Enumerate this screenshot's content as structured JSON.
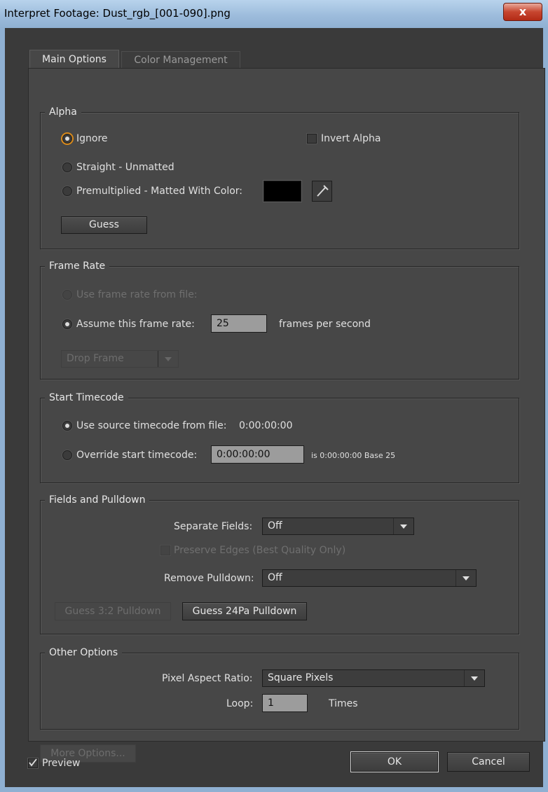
{
  "window": {
    "title": "Interpret Footage: Dust_rgb_[001-090].png",
    "close_glyph": "x"
  },
  "tabs": [
    {
      "label": "Main Options"
    },
    {
      "label": "Color Management"
    }
  ],
  "alpha": {
    "title": "Alpha",
    "ignore_label": "Ignore",
    "invert_label": "Invert Alpha",
    "straight_label": "Straight - Unmatted",
    "premult_label": "Premultiplied - Matted With Color:",
    "matte_color": "#000000",
    "guess_label": "Guess"
  },
  "frame_rate": {
    "title": "Frame Rate",
    "use_file_label": "Use frame rate from file:",
    "assume_label": "Assume this frame rate:",
    "fps_value": "25",
    "fps_suffix": "frames per second",
    "drop_frame": "Drop Frame"
  },
  "start_timecode": {
    "title": "Start Timecode",
    "source_label": "Use source timecode from file:",
    "source_value": "0:00:00:00",
    "override_label": "Override start timecode:",
    "override_value": "0:00:00:00",
    "info": "is 0:00:00:00  Base 25"
  },
  "fields": {
    "title": "Fields and Pulldown",
    "separate_label": "Separate Fields:",
    "separate_value": "Off",
    "preserve_label": "Preserve Edges (Best Quality Only)",
    "remove_label": "Remove Pulldown:",
    "remove_value": "Off",
    "guess32_label": "Guess 3:2 Pulldown",
    "guess24_label": "Guess 24Pa Pulldown"
  },
  "other": {
    "title": "Other Options",
    "par_label": "Pixel Aspect Ratio:",
    "par_value": "Square Pixels",
    "loop_label": "Loop:",
    "loop_value": "1",
    "loop_suffix": "Times"
  },
  "more_options": "More Options...",
  "footer": {
    "preview_label": "Preview",
    "ok_label": "OK",
    "cancel_label": "Cancel"
  },
  "colors": {
    "accent_focus": "#d88a1c",
    "close_button": "#c7452f"
  }
}
